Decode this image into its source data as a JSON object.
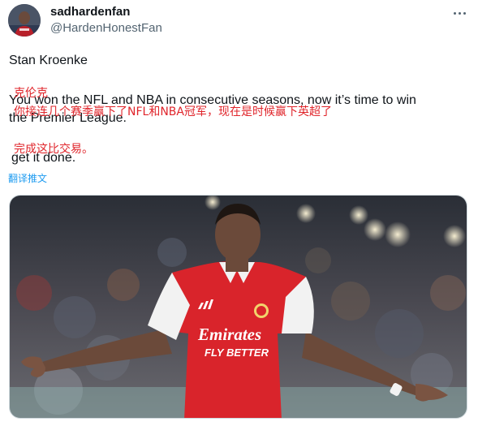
{
  "user": {
    "display_name": "sadhardenfan",
    "handle": "@HardenHonestFan",
    "avatar_icon": "player-avatar"
  },
  "more_icon": "more-options-icon",
  "tweet": {
    "line1": "Stan Kroenke",
    "line2": "You won the NFL and NBA in consecutive seasons, now it’s time to win",
    "line3": "the Premier League.",
    "line4": "get it done."
  },
  "translation_overlay": {
    "line1": "克伦克",
    "line2": "你接连几个赛季赢下了NFL和NBA冠军，现在是时候赢下英超了",
    "line3": "完成这比交易。"
  },
  "translate_link": "翻译推文",
  "media": {
    "shirt_sponsor_line1": "Emirates",
    "shirt_sponsor_line2": "FLY BETTER",
    "colors": {
      "shirt_red": "#d9242b",
      "sleeve_white": "#f2f2f2",
      "skin": "#6b4a3a"
    }
  },
  "colors": {
    "text": "#0f1419",
    "secondary": "#536471",
    "link": "#1d9bf0",
    "overlay_red": "#e0252b"
  }
}
